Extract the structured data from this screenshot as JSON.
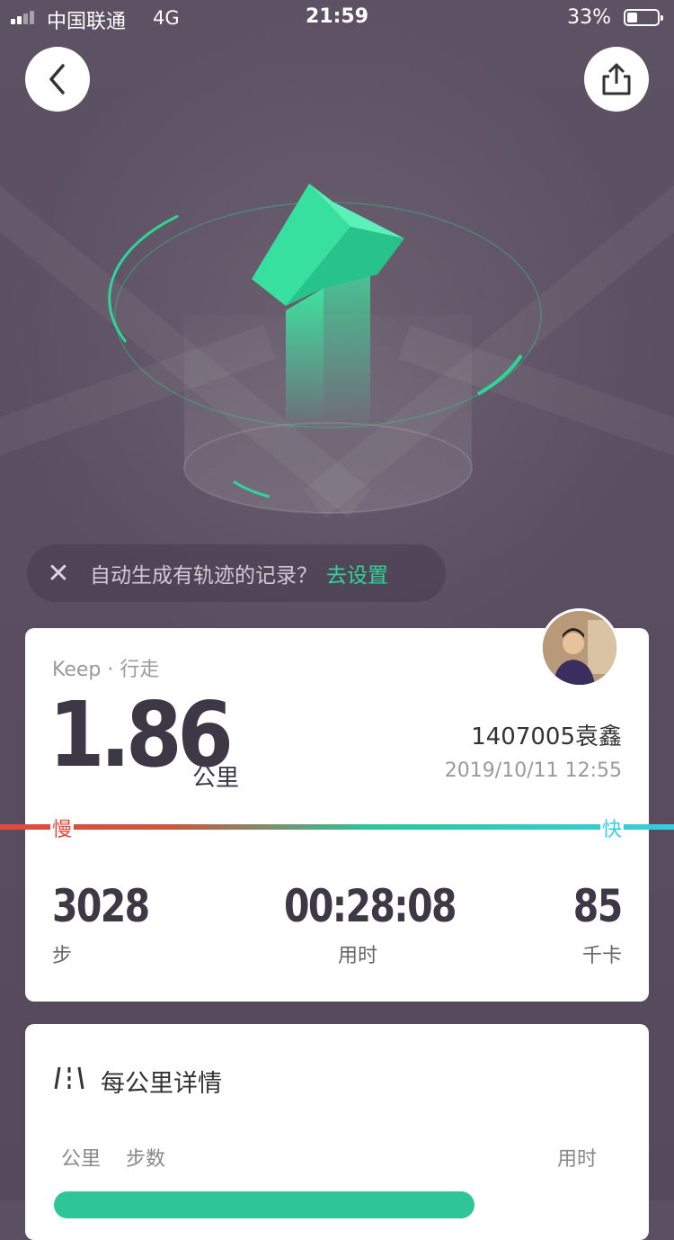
{
  "status_bar": {
    "carrier": "中国联通",
    "network": "4G",
    "time": "21:59",
    "battery_percent": "33%",
    "battery_level": 0.33
  },
  "nav": {
    "back_icon": "chevron-left-icon",
    "share_icon": "share-icon"
  },
  "auto_record": {
    "close_icon": "close-icon",
    "text": "自动生成有轨迹的记录？",
    "link": "去设置"
  },
  "summary": {
    "brand": "Keep · 行走",
    "distance": "1.86",
    "distance_unit": "公里",
    "username": "1407005袁鑫",
    "datetime": "2019/10/11 12:55",
    "pace_slow": "慢",
    "pace_fast": "快",
    "stats": {
      "steps_value": "3028",
      "steps_label": "步",
      "time_value": "00:28:08",
      "time_label": "用时",
      "calories_value": "85",
      "calories_label": "千卡"
    }
  },
  "details": {
    "icon": "road-icon",
    "title": "每公里详情",
    "columns": {
      "km": "公里",
      "steps": "步数",
      "time": "用时"
    }
  },
  "colors": {
    "accent": "#2ed596",
    "slow": "#e24a3f",
    "fast": "#38cfe0",
    "background": "#5b5061"
  }
}
